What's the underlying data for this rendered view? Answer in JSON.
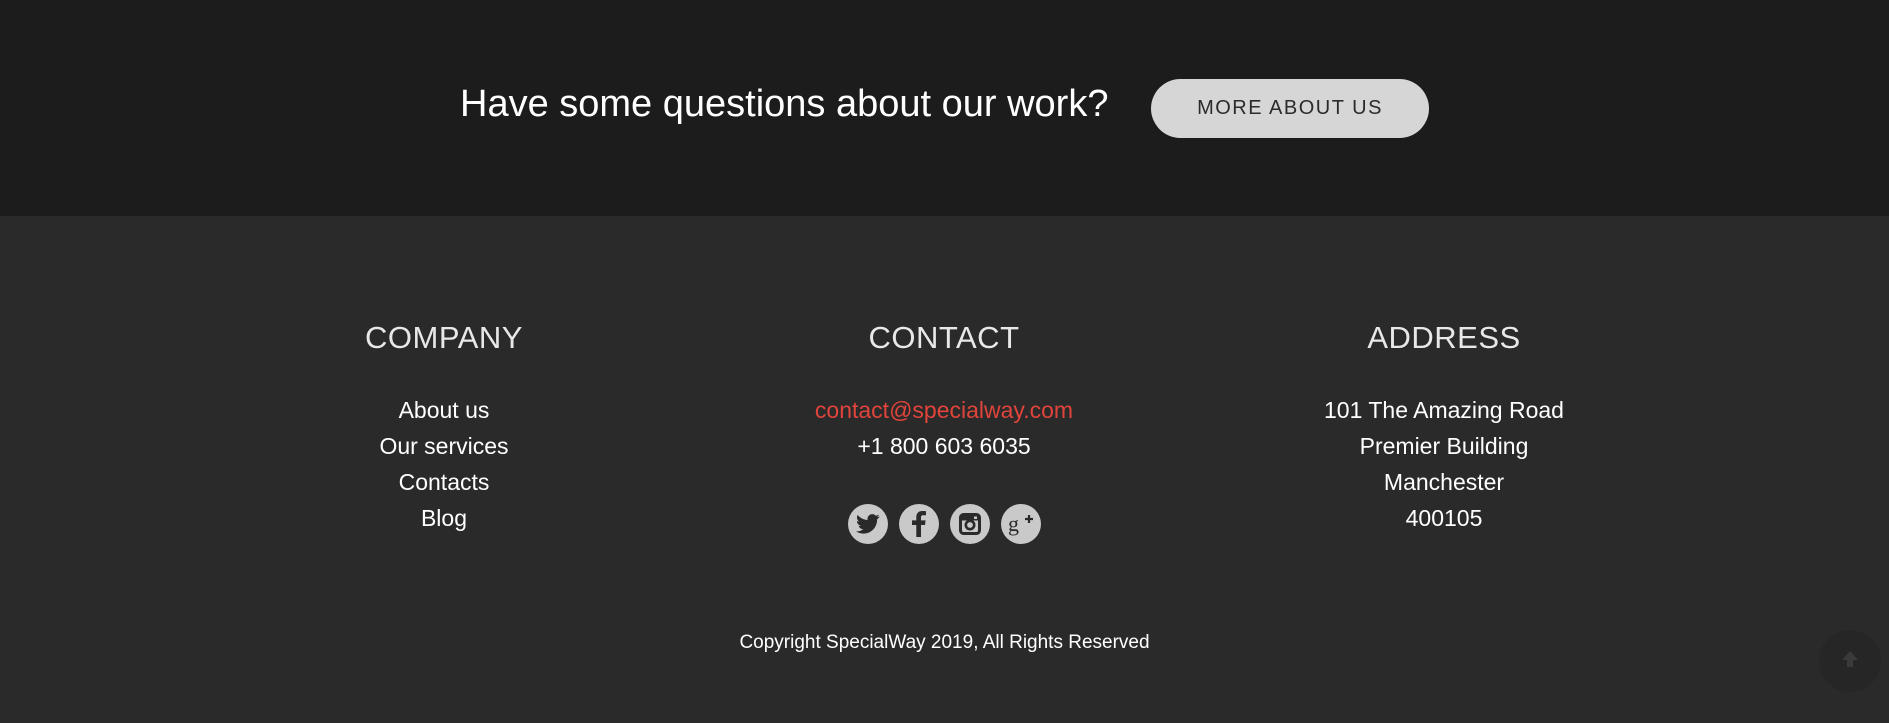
{
  "cta": {
    "text": "Have some questions about our work?",
    "button_label": "MORE ABOUT US"
  },
  "company": {
    "heading": "COMPANY",
    "links": [
      "About us",
      "Our services",
      "Contacts",
      "Blog"
    ]
  },
  "contact": {
    "heading": "CONTACT",
    "email": "contact@specialway.com",
    "phone": "+1 800 603 6035",
    "social": [
      "twitter-icon",
      "facebook-icon",
      "instagram-icon",
      "google-plus-icon"
    ]
  },
  "address": {
    "heading": "ADDRESS",
    "lines": [
      "101 The Amazing Road",
      "Premier Building",
      "Manchester",
      "400105"
    ]
  },
  "copyright": "Copyright SpecialWay 2019, All Rights Reserved",
  "colors": {
    "cta_background": "#1c1c1c",
    "footer_background": "#2a2a2a",
    "email_accent": "#e0443b",
    "button_background": "#d6d6d6"
  }
}
